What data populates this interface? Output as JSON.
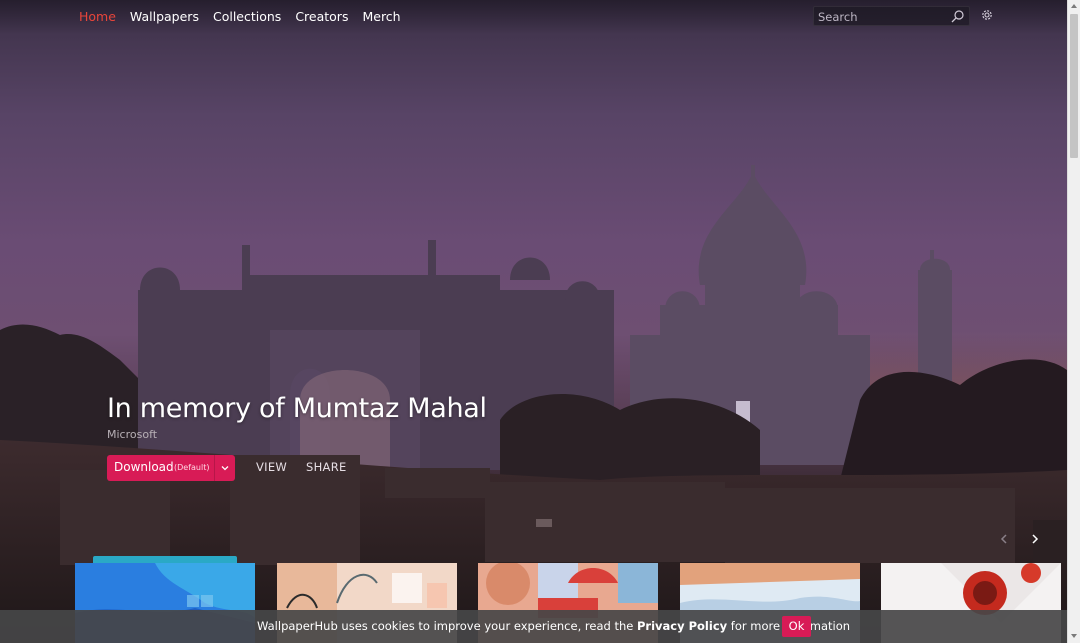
{
  "nav": {
    "links": [
      "Home",
      "Wallpapers",
      "Collections",
      "Creators",
      "Merch"
    ],
    "active": "Home",
    "search_placeholder": "Search",
    "icons": {
      "search": "search-icon",
      "settings": "gear-icon"
    }
  },
  "hero": {
    "title": "In memory of Mumtaz Mahal",
    "author": "Microsoft",
    "download_label": "Download",
    "download_sub": "(Default)",
    "view_label": "VIEW",
    "share_label": "SHARE"
  },
  "thumbnails": [
    {
      "name": "thumb-1",
      "active": true
    },
    {
      "name": "thumb-2",
      "active": false
    },
    {
      "name": "thumb-3",
      "active": false
    },
    {
      "name": "thumb-4",
      "active": false
    },
    {
      "name": "thumb-5",
      "active": false
    }
  ],
  "cookie": {
    "text_before": "WallpaperHub uses cookies to improve your experience, read the ",
    "link": "Privacy Policy",
    "text_after": " for more information",
    "ok_label": "Ok"
  },
  "colors": {
    "accent": "#d81b56",
    "nav_active": "#e8453a",
    "active_thumb_bar": "#2aa9c6"
  }
}
